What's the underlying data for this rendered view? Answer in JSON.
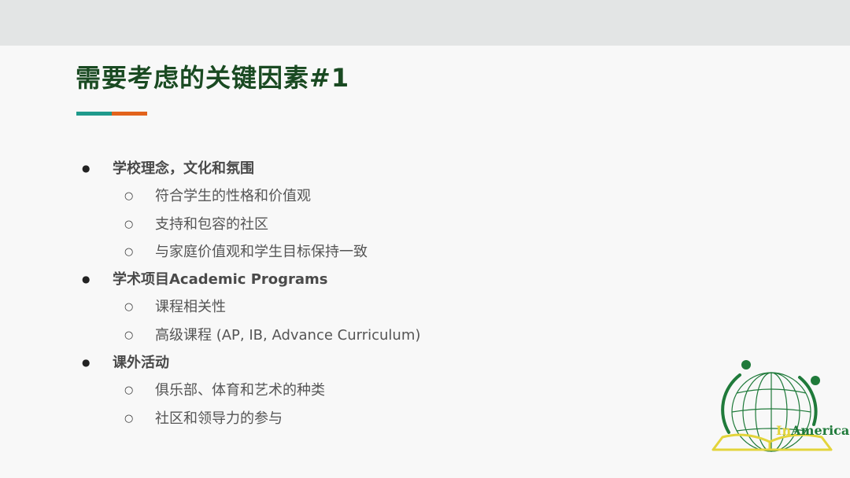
{
  "slide": {
    "title": "需要考虑的关键因素#1"
  },
  "colors": {
    "title": "#1a4a22",
    "accent_teal": "#1f9a8c",
    "accent_orange": "#e2631c",
    "logo_green": "#1f7a3a",
    "logo_yellow": "#e3d43b"
  },
  "bullets": [
    {
      "level": 1,
      "text": "学校理念，文化和氛围"
    },
    {
      "level": 2,
      "text": "符合学生的性格和价值观"
    },
    {
      "level": 2,
      "text": "支持和包容的社区"
    },
    {
      "level": 2,
      "text": "与家庭价值观和学生目标保持一致"
    },
    {
      "level": 1,
      "text": "学术项目Academic Programs"
    },
    {
      "level": 2,
      "text": "课程相关性"
    },
    {
      "level": 2,
      "text": "高级课程 (AP, IB, Advance Curriculum)"
    },
    {
      "level": 1,
      "text": "课外活动"
    },
    {
      "level": 2,
      "text": "俱乐部、体育和艺术的种类"
    },
    {
      "level": 2,
      "text": "社区和领导力的参与"
    }
  ],
  "markers": {
    "level1": "●",
    "level2": "○"
  },
  "logo": {
    "icon": "globe-book-logo",
    "text_prefix": "In",
    "text_rest": "America"
  }
}
